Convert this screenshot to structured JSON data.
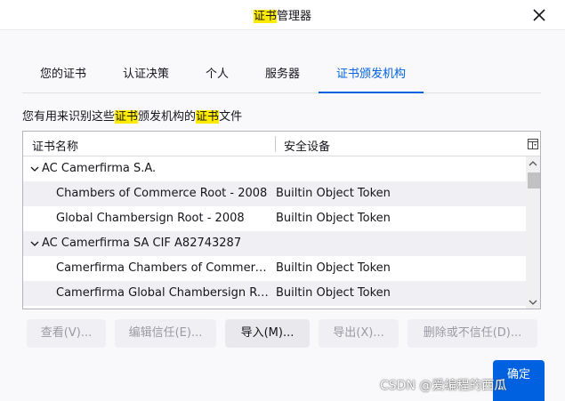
{
  "dialog": {
    "title_highlight": "证书",
    "title_rest": "管理器"
  },
  "tabs": [
    {
      "label": "您的证书"
    },
    {
      "label": "认证决策"
    },
    {
      "label": "个人"
    },
    {
      "label": "服务器"
    },
    {
      "label": "证书颁发机构",
      "active": true
    }
  ],
  "description": {
    "part1": "您有用来识别这些",
    "hl1": "证书",
    "part2": "颁发机构的",
    "hl2": "证书",
    "part3": "文件"
  },
  "tree": {
    "columns": {
      "name": "证书名称",
      "token": "安全设备"
    },
    "groups": [
      {
        "label": "AC Camerfirma S.A.",
        "expanded": true,
        "certs": [
          {
            "name": "Chambers of Commerce Root - 2008",
            "token": "Builtin Object Token"
          },
          {
            "name": "Global Chambersign Root - 2008",
            "token": "Builtin Object Token"
          }
        ]
      },
      {
        "label": "AC Camerfirma SA CIF A82743287",
        "expanded": true,
        "certs": [
          {
            "name": "Camerfirma Chambers of Commerc...",
            "token": "Builtin Object Token"
          },
          {
            "name": "Camerfirma Global Chambersign Ro...",
            "token": "Builtin Object Token"
          }
        ]
      }
    ]
  },
  "buttons": {
    "view": "查看(V)...",
    "edit_trust": "编辑信任(E)...",
    "import": "导入(M)...",
    "export": "导出(X)...",
    "delete": "删除或不信任(D)...",
    "ok": "确定"
  },
  "watermark": "CSDN @爱编程的西瓜",
  "colors": {
    "accent": "#0061e0",
    "highlight": "#ffeb00",
    "alt_row": "#f0f0f4"
  },
  "icons": {
    "close": "close-icon",
    "column_picker": "column-picker-icon",
    "twisty": "chevron-down-icon"
  }
}
